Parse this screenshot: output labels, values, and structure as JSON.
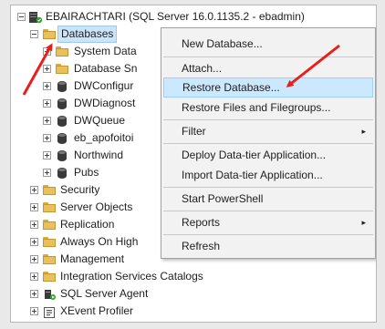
{
  "tree": {
    "server": "EBAIRACHTARI (SQL Server 16.0.1135.2 - ebadmin)",
    "databases": "Databases",
    "children": [
      "System Data",
      "Database Sn",
      "DWConfigur",
      "DWDiagnost",
      "DWQueue",
      "eb_apofoitoi",
      "Northwind",
      "Pubs"
    ],
    "top_level": [
      "Security",
      "Server Objects",
      "Replication",
      "Always On High",
      "Management",
      "Integration Services Catalogs",
      "SQL Server Agent",
      "XEvent Profiler"
    ]
  },
  "context_menu": {
    "items": [
      "New Database...",
      "Attach...",
      "Restore Database...",
      "Restore Files and Filegroups...",
      "Filter",
      "Deploy Data-tier Application...",
      "Import Data-tier Application...",
      "Start PowerShell",
      "Reports",
      "Refresh"
    ],
    "submenu_glyph": "▸"
  },
  "colors": {
    "selection": "#cce4f7",
    "menu_highlight": "#cce8ff",
    "annotation_arrow": "#e8201c",
    "folder": "#e9c05e"
  }
}
